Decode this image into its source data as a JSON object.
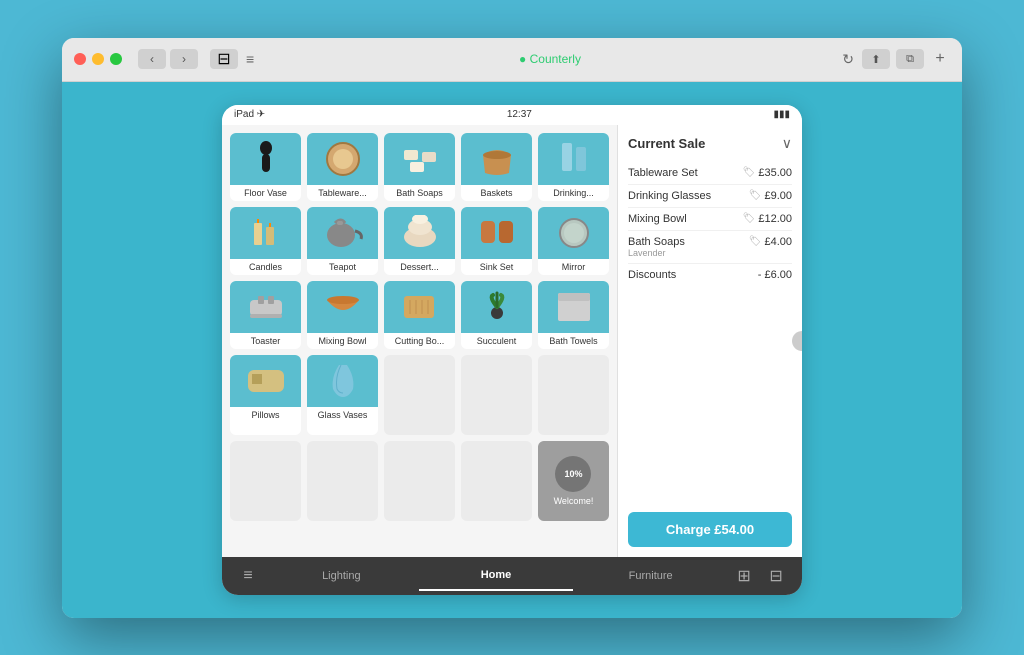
{
  "browser": {
    "traffic_lights": [
      "red",
      "yellow",
      "green"
    ],
    "url": "● Counterly",
    "nav_back": "‹",
    "nav_forward": "›",
    "sidebar_icon": "⊟",
    "hamburger": "≡",
    "refresh": "↻",
    "share_icon": "⬆",
    "duplicate_icon": "⧉",
    "plus_icon": "+"
  },
  "ipad": {
    "status_left": "iPad ✈",
    "status_time": "12:37",
    "status_right": "▮▯ 🔋"
  },
  "products": {
    "row1": [
      {
        "name": "Floor Vase",
        "color": "#5bbecf"
      },
      {
        "name": "Tableware...",
        "color": "#5bbecf"
      },
      {
        "name": "Bath Soaps",
        "color": "#5bbecf"
      },
      {
        "name": "Baskets",
        "color": "#5bbecf"
      },
      {
        "name": "Drinking...",
        "color": "#5bbecf"
      }
    ],
    "row2": [
      {
        "name": "Candles",
        "color": "#5bbecf"
      },
      {
        "name": "Teapot",
        "color": "#5bbecf"
      },
      {
        "name": "Dessert...",
        "color": "#5bbecf"
      },
      {
        "name": "Sink Set",
        "color": "#5bbecf"
      },
      {
        "name": "Mirror",
        "color": "#5bbecf"
      }
    ],
    "row3": [
      {
        "name": "Toaster",
        "color": "#5bbecf"
      },
      {
        "name": "Mixing Bowl",
        "color": "#5bbecf"
      },
      {
        "name": "Cutting Bo...",
        "color": "#5bbecf"
      },
      {
        "name": "Succulent",
        "color": "#5bbecf"
      },
      {
        "name": "Bath Towels",
        "color": "#5bbecf"
      }
    ],
    "row4": [
      {
        "name": "Pillows",
        "color": "#5bbecf"
      },
      {
        "name": "Glass Vases",
        "color": "#5bbecf"
      },
      {
        "name": "",
        "color": "#ebebeb",
        "empty": true
      },
      {
        "name": "",
        "color": "#ebebeb",
        "empty": true
      },
      {
        "name": "",
        "color": "#ebebeb",
        "empty": true
      }
    ],
    "row5": [
      {
        "name": "",
        "color": "#ebebeb",
        "empty": true
      },
      {
        "name": "",
        "color": "#ebebeb",
        "empty": true
      },
      {
        "name": "",
        "color": "#ebebeb",
        "empty": true
      },
      {
        "name": "",
        "color": "#ebebeb",
        "empty": true
      },
      {
        "name": "welcome",
        "special": true
      }
    ]
  },
  "sale": {
    "title": "Current Sale",
    "chevron": "∨",
    "items": [
      {
        "name": "Tableware Set",
        "price": "£35.00"
      },
      {
        "name": "Drinking Glasses",
        "price": "£9.00"
      },
      {
        "name": "Mixing Bowl",
        "price": "£12.00"
      },
      {
        "name": "Bath Soaps",
        "subtitle": "Lavender",
        "price": "£4.00"
      },
      {
        "label": "Discounts",
        "value": "- £6.00"
      }
    ],
    "charge_label": "Charge £54.00"
  },
  "tabs": {
    "menu_icon": "≡",
    "items": [
      {
        "label": "Lighting",
        "active": false
      },
      {
        "label": "Home",
        "active": true
      },
      {
        "label": "Furniture",
        "active": false
      }
    ],
    "grid_icon": "⊞",
    "calc_icon": "⊟"
  },
  "welcome_badge": {
    "percent": "10%",
    "label": "Welcome!"
  }
}
